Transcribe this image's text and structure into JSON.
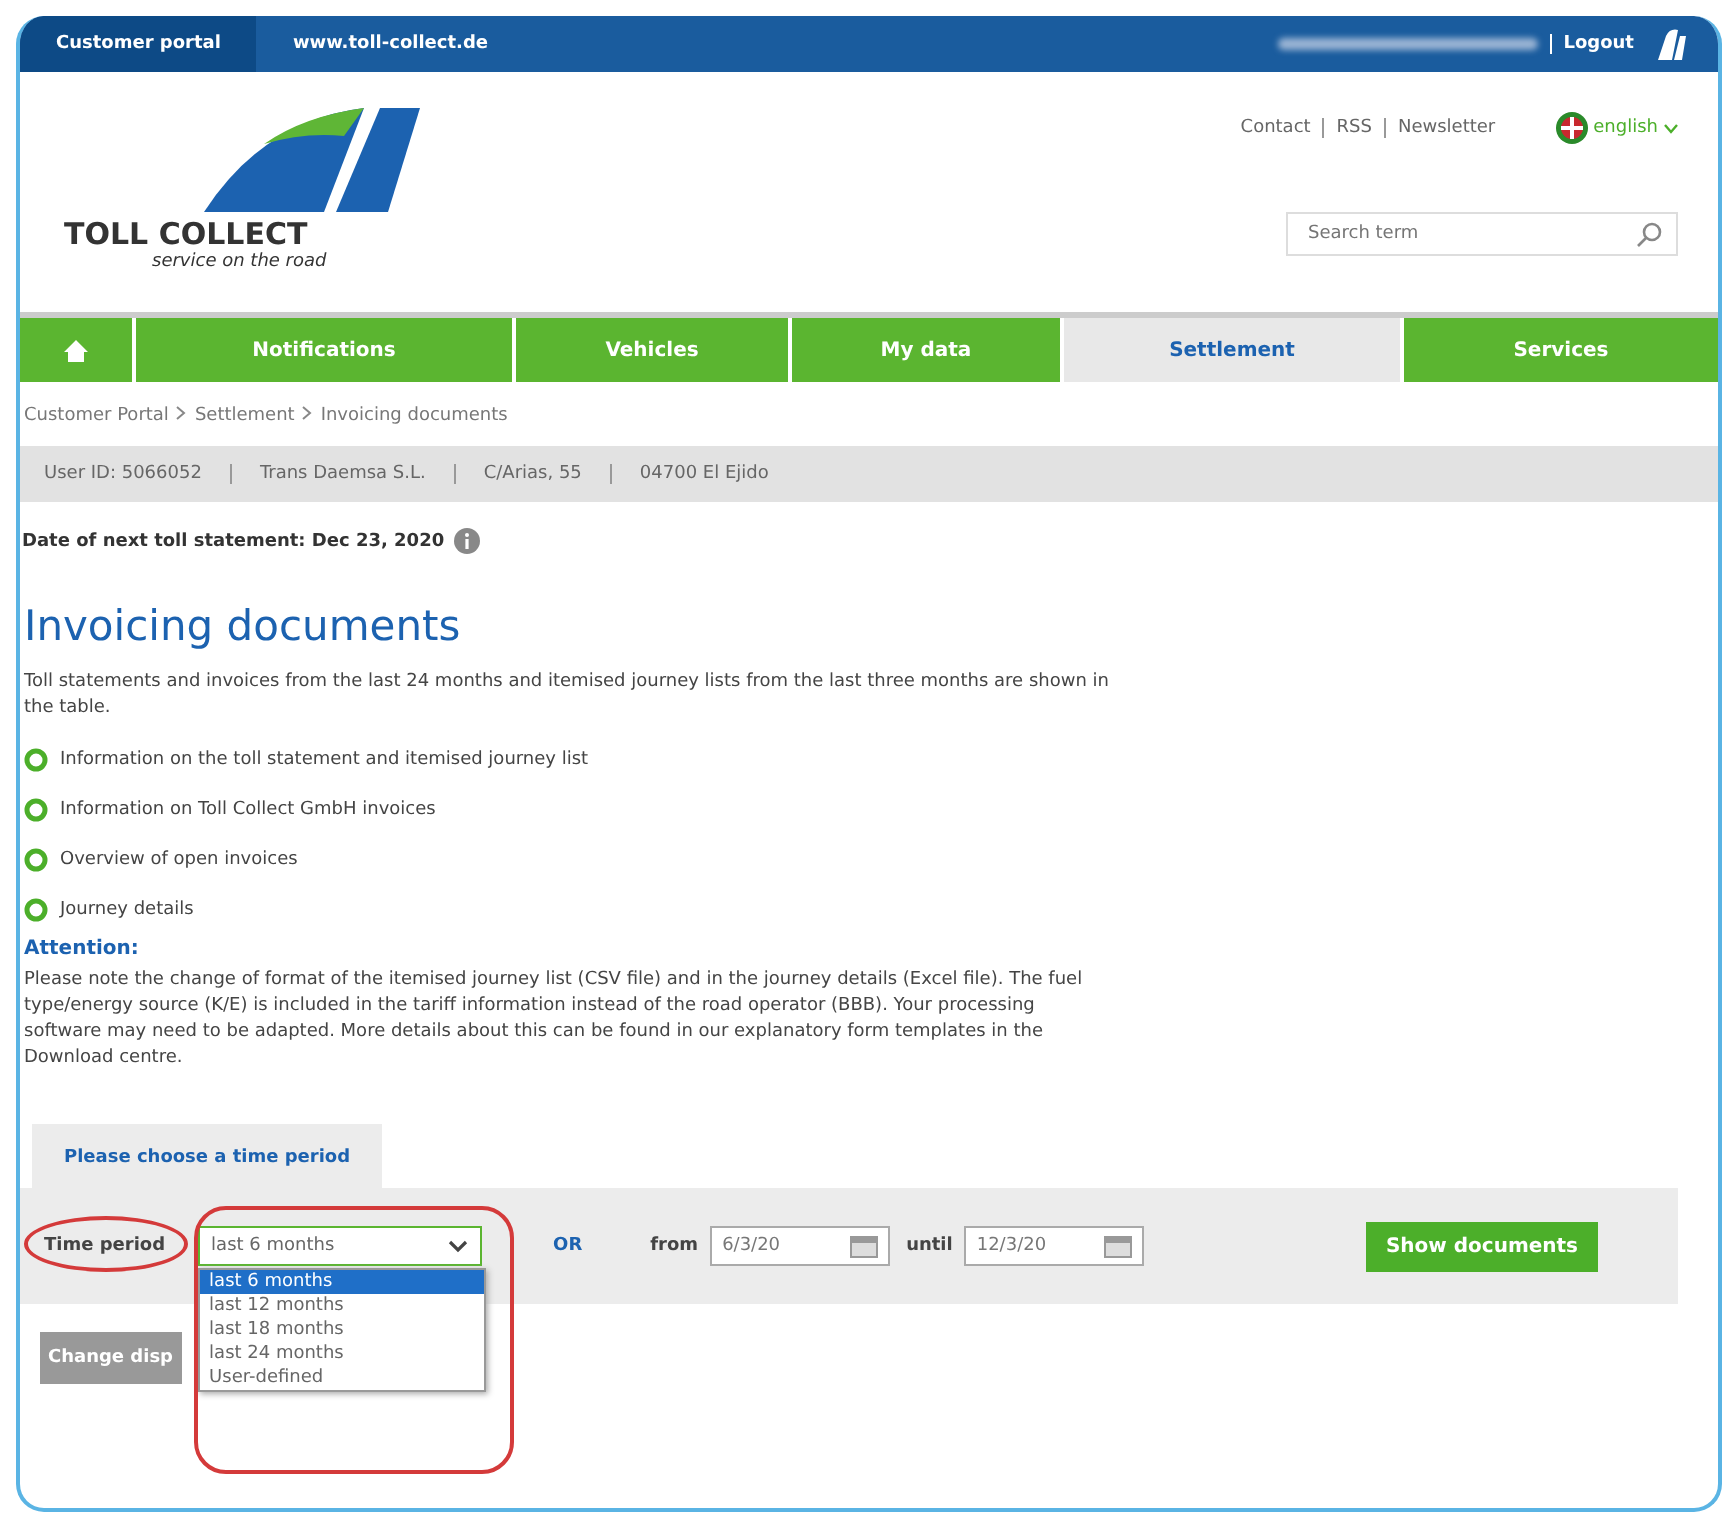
{
  "top_bar": {
    "tabs": [
      {
        "label": "Customer portal",
        "selected": true
      },
      {
        "label": "www.toll-collect.de",
        "selected": false
      }
    ],
    "logout": "Logout"
  },
  "header": {
    "logo": {
      "name": "TOLL COLLECT",
      "tagline": "service on the road"
    },
    "links": [
      "Contact",
      "RSS",
      "Newsletter"
    ],
    "language": "english",
    "search": {
      "placeholder": "Search term"
    }
  },
  "nav": [
    {
      "label": "Notifications",
      "selected": false
    },
    {
      "label": "Vehicles",
      "selected": false
    },
    {
      "label": "My data",
      "selected": false
    },
    {
      "label": "Settlement",
      "selected": true
    },
    {
      "label": "Services",
      "selected": false
    }
  ],
  "breadcrumb": [
    "Customer Portal",
    "Settlement",
    "Invoicing documents"
  ],
  "user_info": [
    "User ID: 5066052",
    "Trans Daemsa S.L.",
    "C/Arias, 55",
    "04700 El Ejido"
  ],
  "next_statement": "Date of next toll statement: Dec 23, 2020",
  "title": "Invoicing documents",
  "intro": "Toll statements and invoices from the last 24 months and itemised journey lists from the last three months are shown in the table.",
  "info_links": [
    "Information on the toll statement and itemised journey list",
    "Information on Toll Collect GmbH invoices",
    "Overview of open invoices",
    "Journey details"
  ],
  "attention": {
    "heading": "Attention:",
    "text": "Please note the change of format of the itemised journey list (CSV file) and in the journey details (Excel file). The fuel type/energy source (K/E) is included in the tariff information instead of the road operator (BBB). Your processing software may need to be adapted. More details about this can be found in our explanatory form templates in the Download centre."
  },
  "filter": {
    "tab": "Please choose a time period",
    "label": "Time period",
    "select": {
      "value": "last 6 months",
      "options": [
        {
          "label": "last 6 months",
          "selected": true
        },
        {
          "label": "last 12 months",
          "selected": false
        },
        {
          "label": "last 18 months",
          "selected": false
        },
        {
          "label": "last 24 months",
          "selected": false
        },
        {
          "label": "User-defined",
          "selected": false
        }
      ]
    },
    "or": "OR",
    "from_label": "from",
    "from": "6/3/20",
    "until_label": "until",
    "until": "12/3/20",
    "button": "Show documents"
  },
  "change_display": "Change disp"
}
